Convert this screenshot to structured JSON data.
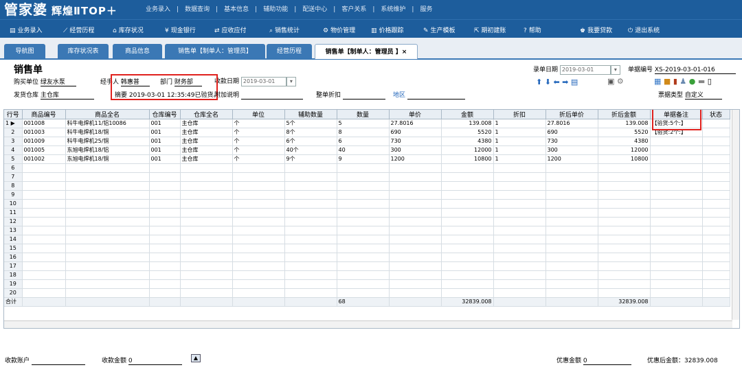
{
  "app": {
    "logo": "管家婆",
    "logo_sub": "辉煌ⅡTOP＋",
    "topmenu": [
      "业务录入",
      "|",
      "数据查询",
      "|",
      "基本信息",
      "|",
      "辅助功能",
      "|",
      "配送中心",
      "|",
      "客户关系",
      "|",
      "系统维护",
      "|",
      "服务"
    ]
  },
  "nav": [
    "业务录入",
    "经营历程",
    "库存状况",
    "现金银行",
    "应收应付",
    "销售统计",
    "物价管理",
    "价格跟踪",
    "生产模板",
    "期初建账",
    "帮助",
    "我要贷款",
    "退出系统"
  ],
  "nav_icons": [
    "bars-icon",
    "chart-icon",
    "home-icon",
    "yen-icon",
    "arrows-icon",
    "search-icon",
    "gear-icon",
    "bar-chart-icon",
    "wrench-icon",
    "export-icon",
    "help-icon",
    "money-icon",
    "power-icon"
  ],
  "tabs": [
    "导航图",
    "库存状况表",
    "商品信息",
    "销售单【制单人：管理员】",
    "经营历程",
    "销售单【制单人：管理员 】×"
  ],
  "form": {
    "title": "销售单",
    "buyer_label": "购买单位",
    "buyer": "绿友水泵",
    "handler_label": "经手人",
    "handler": "韩惠普",
    "dept_label": "部门",
    "dept": "财务部",
    "collect_date_label": "收款日期",
    "collect_date": "2019-03-01",
    "record_date_label": "录单日期",
    "record_date": "2019-03-01",
    "doc_no_label": "单据编号",
    "doc_no": "XS-2019-03-01-016",
    "warehouse_label": "发货仓库",
    "warehouse": "主仓库",
    "summary_label": "摘要",
    "summary": "2019-03-01 12:35:49已验货。",
    "extra_label": "附加说明",
    "discount_label": "整单折扣",
    "area_label": "地区",
    "doc_type_label": "票据类型",
    "doc_type": "自定义"
  },
  "table": {
    "headers": [
      "行号",
      "商品编号",
      "商品全名",
      "仓库编号",
      "仓库全名",
      "单位",
      "辅助数量",
      "数量",
      "单价",
      "金额",
      "折扣",
      "折后单价",
      "折后金额",
      "单据备注",
      "状态"
    ],
    "rows": [
      [
        "1",
        "001008",
        "科牛电焊机11/铝10086",
        "001",
        "主仓库",
        "个",
        "5个",
        "5",
        "27.8016",
        "139.008",
        "1",
        "27.8016",
        "139.008",
        "【验货:5个:】",
        ""
      ],
      [
        "2",
        "001003",
        "科牛电焊机18/铜",
        "001",
        "主仓库",
        "个",
        "8个",
        "8",
        "690",
        "5520",
        "1",
        "690",
        "5520",
        "【验货:2个:】",
        ""
      ],
      [
        "3",
        "001009",
        "科牛电焊机25/铜",
        "001",
        "主仓库",
        "个",
        "6个",
        "6",
        "730",
        "4380",
        "1",
        "730",
        "4380",
        "",
        ""
      ],
      [
        "4",
        "001005",
        "东旭电焊机18/铝",
        "001",
        "主仓库",
        "个",
        "40个",
        "40",
        "300",
        "12000",
        "1",
        "300",
        "12000",
        "",
        ""
      ],
      [
        "5",
        "001002",
        "东旭电焊机18/铜",
        "001",
        "主仓库",
        "个",
        "9个",
        "9",
        "1200",
        "10800",
        "1",
        "1200",
        "10800",
        "",
        ""
      ],
      [
        "6",
        "",
        "",
        "",
        "",
        "",
        "",
        "",
        "",
        "",
        "",
        "",
        "",
        "",
        ""
      ],
      [
        "7",
        "",
        "",
        "",
        "",
        "",
        "",
        "",
        "",
        "",
        "",
        "",
        "",
        "",
        ""
      ],
      [
        "8",
        "",
        "",
        "",
        "",
        "",
        "",
        "",
        "",
        "",
        "",
        "",
        "",
        "",
        ""
      ],
      [
        "9",
        "",
        "",
        "",
        "",
        "",
        "",
        "",
        "",
        "",
        "",
        "",
        "",
        "",
        ""
      ],
      [
        "10",
        "",
        "",
        "",
        "",
        "",
        "",
        "",
        "",
        "",
        "",
        "",
        "",
        "",
        ""
      ],
      [
        "11",
        "",
        "",
        "",
        "",
        "",
        "",
        "",
        "",
        "",
        "",
        "",
        "",
        "",
        ""
      ],
      [
        "12",
        "",
        "",
        "",
        "",
        "",
        "",
        "",
        "",
        "",
        "",
        "",
        "",
        "",
        ""
      ],
      [
        "13",
        "",
        "",
        "",
        "",
        "",
        "",
        "",
        "",
        "",
        "",
        "",
        "",
        "",
        ""
      ],
      [
        "14",
        "",
        "",
        "",
        "",
        "",
        "",
        "",
        "",
        "",
        "",
        "",
        "",
        "",
        ""
      ],
      [
        "15",
        "",
        "",
        "",
        "",
        "",
        "",
        "",
        "",
        "",
        "",
        "",
        "",
        "",
        ""
      ],
      [
        "16",
        "",
        "",
        "",
        "",
        "",
        "",
        "",
        "",
        "",
        "",
        "",
        "",
        "",
        ""
      ],
      [
        "17",
        "",
        "",
        "",
        "",
        "",
        "",
        "",
        "",
        "",
        "",
        "",
        "",
        "",
        ""
      ],
      [
        "18",
        "",
        "",
        "",
        "",
        "",
        "",
        "",
        "",
        "",
        "",
        "",
        "",
        "",
        ""
      ],
      [
        "19",
        "",
        "",
        "",
        "",
        "",
        "",
        "",
        "",
        "",
        "",
        "",
        "",
        "",
        ""
      ],
      [
        "20",
        "",
        "",
        "",
        "",
        "",
        "",
        "",
        "",
        "",
        "",
        "",
        "",
        "",
        ""
      ]
    ],
    "total": [
      "合计",
      "",
      "",
      "",
      "",
      "",
      "",
      "68",
      "",
      "32839.008",
      "",
      "",
      "32839.008",
      "",
      ""
    ]
  },
  "bottom": {
    "account_label": "收款账户",
    "amount_label": "收款金额",
    "amount": "0",
    "discount_amount_label": "优惠金额",
    "discount_amount": "0",
    "after_label": "优惠后金额：",
    "after": "32839.008"
  }
}
